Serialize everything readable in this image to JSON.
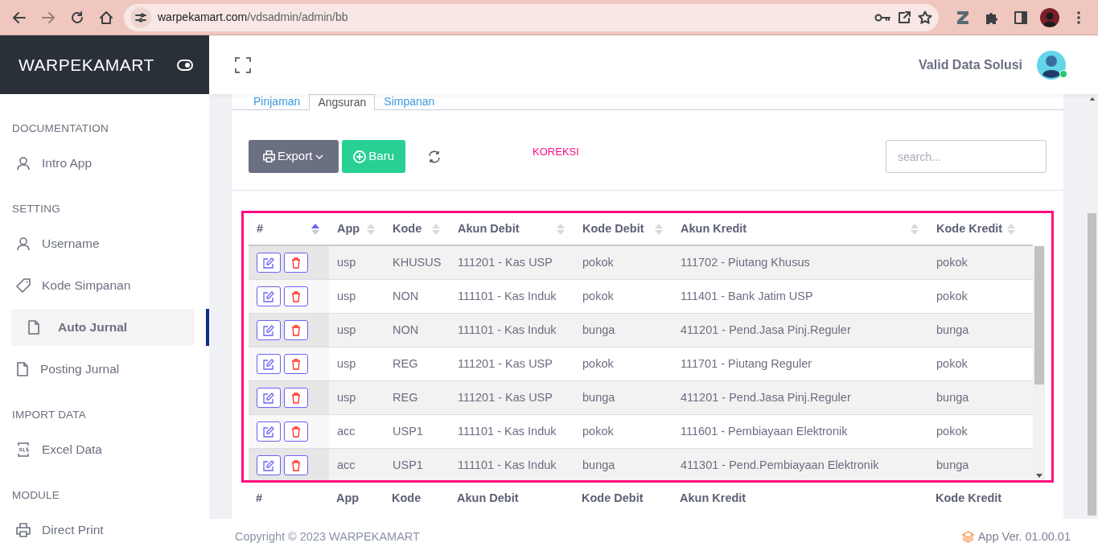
{
  "browser": {
    "url_host": "warpekamart.com",
    "url_path": "/vdsadmin/admin/bb"
  },
  "sidebar": {
    "brand": "WARPEKAMART",
    "sections": [
      {
        "title": "DOCUMENTATION",
        "items": [
          {
            "label": "Intro App",
            "kind": "user",
            "selected": false
          }
        ]
      },
      {
        "title": "SETTING",
        "items": [
          {
            "label": "Username",
            "kind": "user",
            "selected": false
          },
          {
            "label": "Kode Simpanan",
            "kind": "tag",
            "selected": false
          },
          {
            "label": "Auto Jurnal",
            "kind": "file",
            "selected": true
          },
          {
            "label": "Posting Jurnal",
            "kind": "file",
            "selected": false
          }
        ]
      },
      {
        "title": "IMPORT DATA",
        "items": [
          {
            "label": "Excel Data",
            "kind": "xls",
            "selected": false
          }
        ]
      },
      {
        "title": "MODULE",
        "items": [
          {
            "label": "Direct Print",
            "kind": "printer",
            "selected": false
          }
        ]
      }
    ]
  },
  "header": {
    "user_name": "Valid Data Solusi"
  },
  "tabs": [
    {
      "label": "Pinjaman",
      "selected": false
    },
    {
      "label": "Angsuran",
      "selected": true
    },
    {
      "label": "Simpanan",
      "selected": false
    }
  ],
  "toolbar": {
    "export_button": "Export",
    "new_button": "Baru",
    "note": "KOREKSI",
    "search": {
      "placeholder": "search..."
    }
  },
  "table": {
    "columns": [
      {
        "label": "#",
        "sorted": true
      },
      {
        "label": "App",
        "sorted": false
      },
      {
        "label": "Kode",
        "sorted": false
      },
      {
        "label": "Akun Debit",
        "sorted": false
      },
      {
        "label": "Kode Debit",
        "sorted": false
      },
      {
        "label": "Akun Kredit",
        "sorted": false
      },
      {
        "label": "Kode Kredit",
        "sorted": false
      }
    ],
    "rows": [
      {
        "cells": [
          "",
          "usp",
          "KHUSUS",
          "111201 - Kas USP",
          "pokok",
          "111702 - Piutang Khusus",
          "pokok"
        ]
      },
      {
        "cells": [
          "",
          "usp",
          "NON",
          "111101 - Kas Induk",
          "pokok",
          "111401 - Bank Jatim USP",
          "pokok"
        ]
      },
      {
        "cells": [
          "",
          "usp",
          "NON",
          "111101 - Kas Induk",
          "bunga",
          "411201 - Pend.Jasa Pinj.Reguler",
          "bunga"
        ]
      },
      {
        "cells": [
          "",
          "usp",
          "REG",
          "111201 - Kas USP",
          "pokok",
          "111701 - Piutang Reguler",
          "pokok"
        ]
      },
      {
        "cells": [
          "",
          "usp",
          "REG",
          "111201 - Kas USP",
          "bunga",
          "411201 - Pend.Jasa Pinj.Reguler",
          "bunga"
        ]
      },
      {
        "cells": [
          "",
          "acc",
          "USP1",
          "111101 - Kas Induk",
          "pokok",
          "111601 - Pembiayaan Elektronik",
          "pokok"
        ]
      },
      {
        "cells": [
          "",
          "acc",
          "USP1",
          "111101 - Kas Induk",
          "bunga",
          "411301 - Pend.Pembiayaan Elektronik",
          "bunga"
        ]
      }
    ],
    "footer_columns": [
      "#",
      "App",
      "Kode",
      "Akun Debit",
      "Kode Debit",
      "Akun Kredit",
      "Kode Kredit"
    ]
  },
  "footer": {
    "copyright": "Copyright © 2023 WARPEKAMART",
    "version": "App Ver. 01.00.01"
  }
}
